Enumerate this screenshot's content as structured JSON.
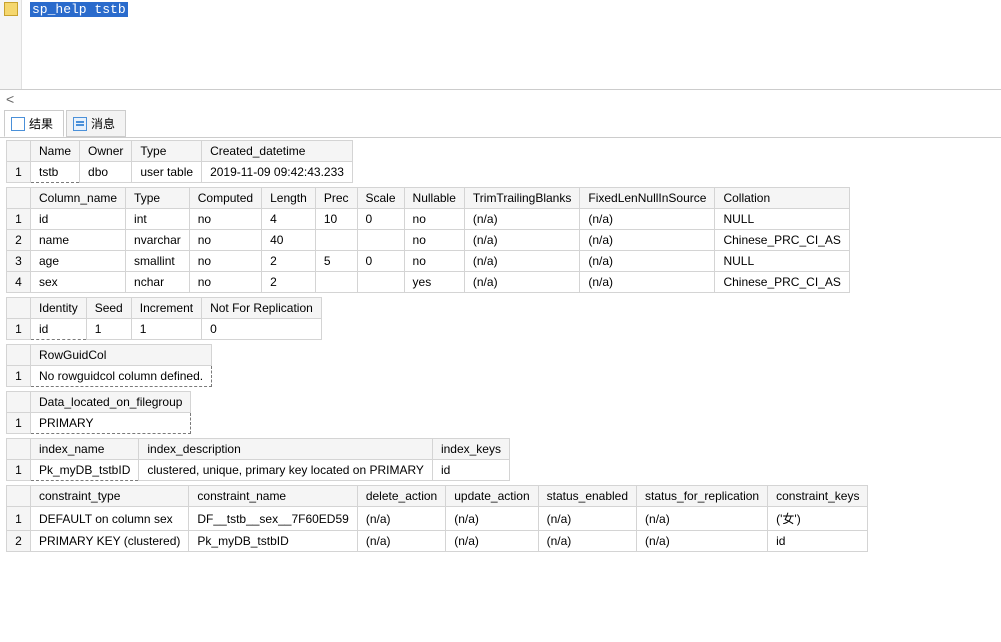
{
  "editor": {
    "code": "sp_help tstb"
  },
  "scrollHint": "<",
  "tabs": {
    "results": "结果",
    "messages": "消息"
  },
  "block1": {
    "headers": [
      "Name",
      "Owner",
      "Type",
      "Created_datetime"
    ],
    "rownum": "1",
    "cells": [
      "tstb",
      "dbo",
      "user table",
      "2019-11-09 09:42:43.233"
    ]
  },
  "block2": {
    "headers": [
      "Column_name",
      "Type",
      "Computed",
      "Length",
      "Prec",
      "Scale",
      "Nullable",
      "TrimTrailingBlanks",
      "FixedLenNullInSource",
      "Collation"
    ],
    "rows": [
      {
        "n": "1",
        "c": [
          "id",
          "int",
          "no",
          "4",
          "10",
          "0",
          "no",
          "(n/a)",
          "(n/a)",
          "NULL"
        ]
      },
      {
        "n": "2",
        "c": [
          "name",
          "nvarchar",
          "no",
          "40",
          "",
          "",
          "no",
          "(n/a)",
          "(n/a)",
          "Chinese_PRC_CI_AS"
        ]
      },
      {
        "n": "3",
        "c": [
          "age",
          "smallint",
          "no",
          "2",
          "5",
          "0",
          "no",
          "(n/a)",
          "(n/a)",
          "NULL"
        ]
      },
      {
        "n": "4",
        "c": [
          "sex",
          "nchar",
          "no",
          "2",
          "",
          "",
          "yes",
          "(n/a)",
          "(n/a)",
          "Chinese_PRC_CI_AS"
        ]
      }
    ]
  },
  "block3": {
    "headers": [
      "Identity",
      "Seed",
      "Increment",
      "Not For Replication"
    ],
    "rownum": "1",
    "cells": [
      "id",
      "1",
      "1",
      "0"
    ]
  },
  "block4": {
    "headers": [
      "RowGuidCol"
    ],
    "rownum": "1",
    "cells": [
      "No rowguidcol column defined."
    ]
  },
  "block5": {
    "headers": [
      "Data_located_on_filegroup"
    ],
    "rownum": "1",
    "cells": [
      "PRIMARY"
    ]
  },
  "block6": {
    "headers": [
      "index_name",
      "index_description",
      "index_keys"
    ],
    "rownum": "1",
    "cells": [
      "Pk_myDB_tstbID",
      "clustered, unique, primary key located on PRIMARY",
      "id"
    ]
  },
  "block7": {
    "headers": [
      "constraint_type",
      "constraint_name",
      "delete_action",
      "update_action",
      "status_enabled",
      "status_for_replication",
      "constraint_keys"
    ],
    "rows": [
      {
        "n": "1",
        "c": [
          "DEFAULT on column sex",
          "DF__tstb__sex__7F60ED59",
          "(n/a)",
          "(n/a)",
          "(n/a)",
          "(n/a)",
          "('女')"
        ]
      },
      {
        "n": "2",
        "c": [
          "PRIMARY KEY (clustered)",
          "Pk_myDB_tstbID",
          "(n/a)",
          "(n/a)",
          "(n/a)",
          "(n/a)",
          "id"
        ]
      }
    ]
  }
}
